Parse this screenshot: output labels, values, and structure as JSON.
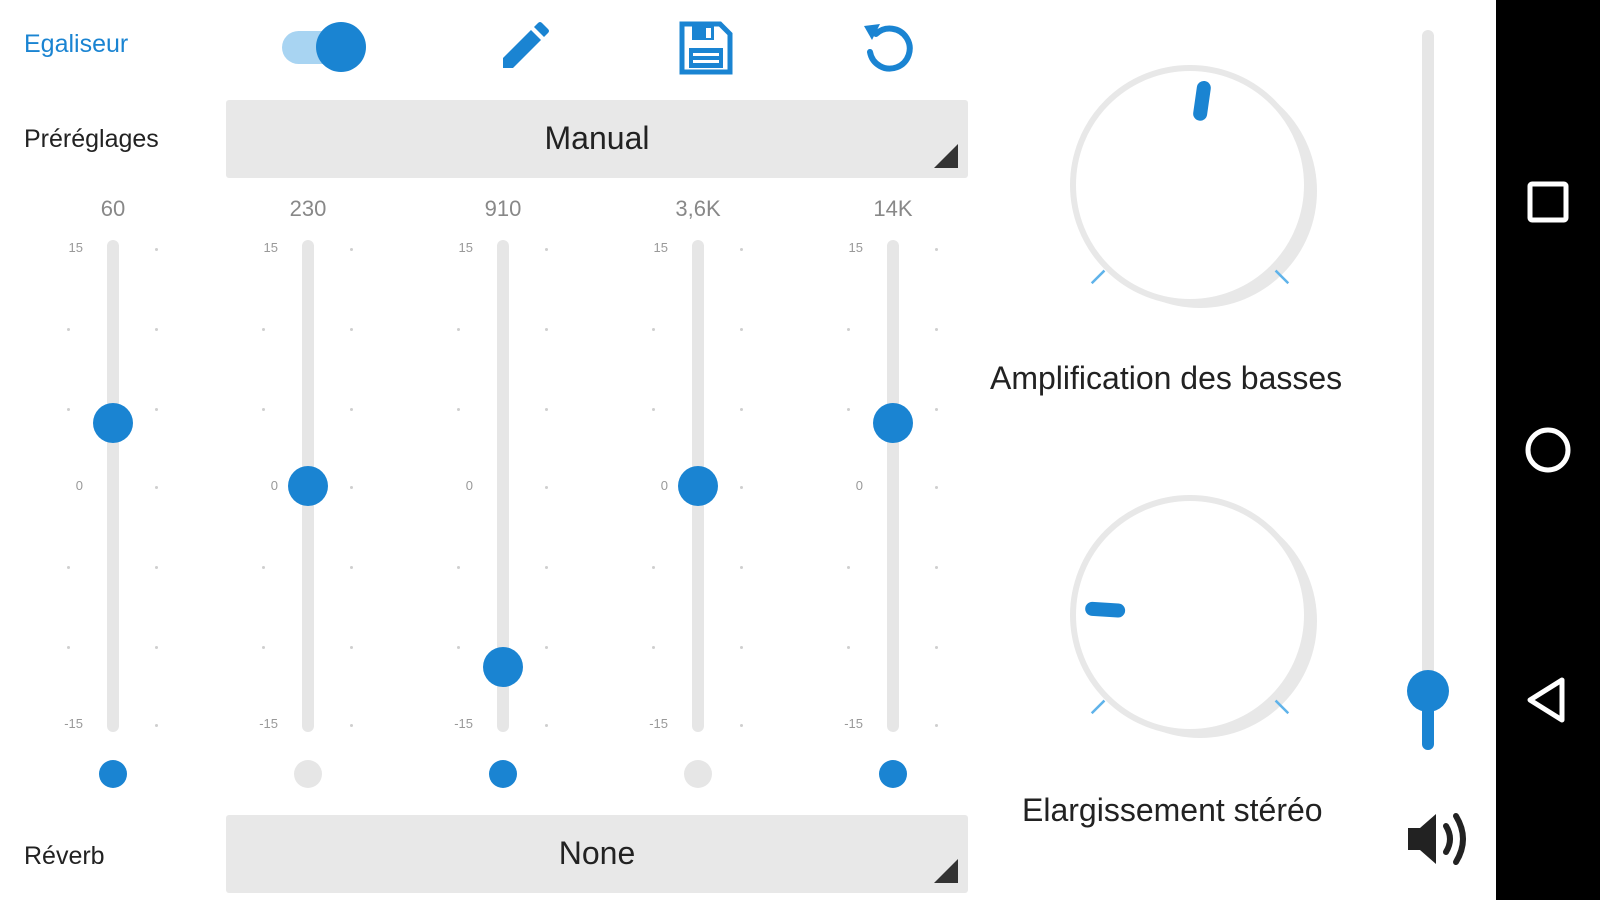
{
  "header": {
    "title": "Egaliseur",
    "toggle_state": "on",
    "icons": [
      "pencil-icon",
      "floppy-save-icon",
      "reset-icon"
    ]
  },
  "presets": {
    "label": "Préréglages",
    "value": "Manual"
  },
  "scale": {
    "max": "15",
    "mid": "0",
    "min": "-15"
  },
  "bands": [
    {
      "freq": "60",
      "gain_db": 4,
      "lock": "on"
    },
    {
      "freq": "230",
      "gain_db": 0,
      "lock": "off"
    },
    {
      "freq": "910",
      "gain_db": -11.4,
      "lock": "on"
    },
    {
      "freq": "3,6K",
      "gain_db": 0,
      "lock": "off"
    },
    {
      "freq": "14K",
      "gain_db": 4,
      "lock": "on"
    }
  ],
  "reverb": {
    "label": "Réverb",
    "value": "None"
  },
  "bass_boost": {
    "label": "Amplification des basses",
    "level": 0.53
  },
  "stereo_widening": {
    "label": "Elargissement stéréo",
    "level": 0.18
  },
  "volume": {
    "level": 0.08,
    "icon": "speaker-icon"
  },
  "colors": {
    "accent": "#1a84d2",
    "accent_light": "#a8d4f2",
    "track": "#e6e6e6",
    "dropdown_bg": "#e8e8e8",
    "navbar": "#000000"
  },
  "navbar": {
    "icons": [
      "recents-square-icon",
      "home-circle-icon",
      "back-triangle-icon"
    ]
  }
}
